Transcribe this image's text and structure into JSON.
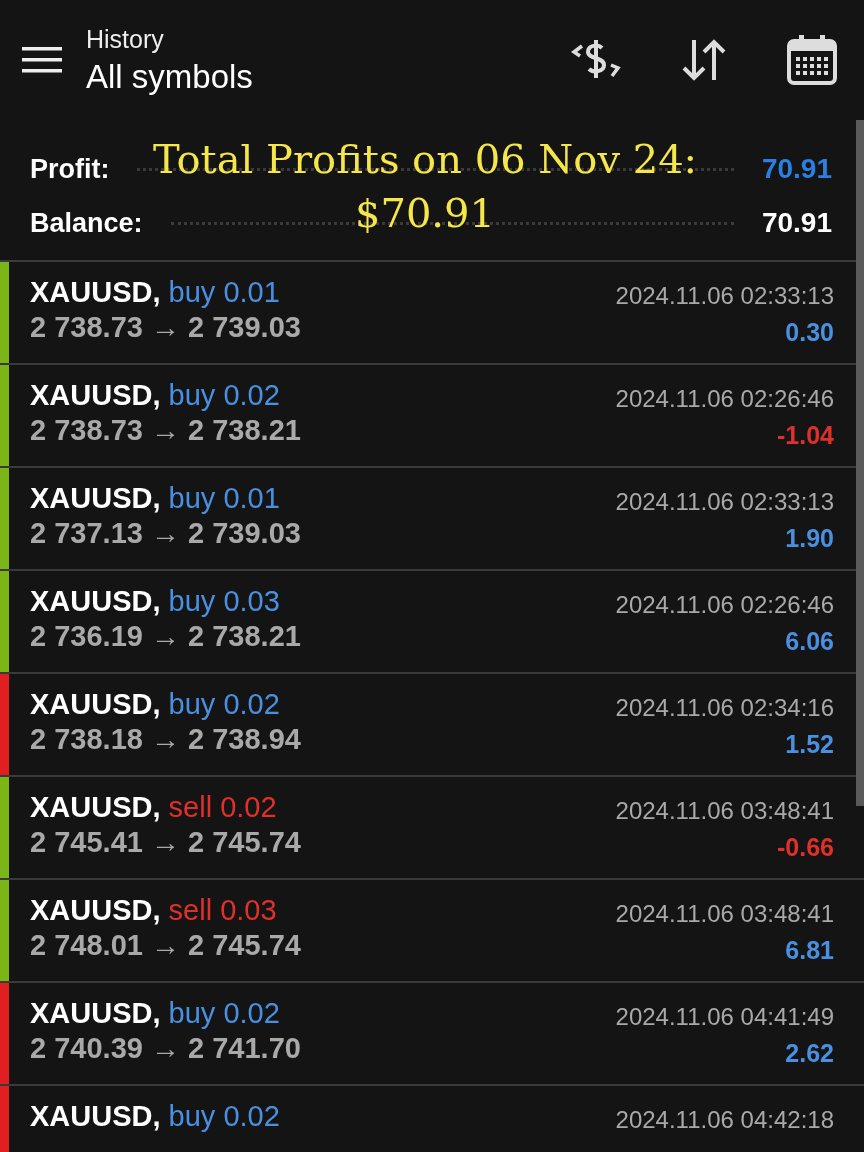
{
  "header": {
    "subtitle": "History",
    "title": "All symbols"
  },
  "summary": {
    "profit_label": "Profit:",
    "profit_value": "70.91",
    "balance_label": "Balance:",
    "balance_value": "70.91"
  },
  "caption": {
    "line_1": "Total Profits on 06 Nov 24:",
    "line_2": "$70.91"
  },
  "deals": [
    {
      "symbol": "XAUUSD,",
      "kind": "buy",
      "order": "buy 0.01",
      "prices": "2 738.73 → 2 739.03",
      "time": "2024.11.06 02:33:13",
      "profit": "0.30",
      "loss": false,
      "color": "#7cb518"
    },
    {
      "symbol": "XAUUSD,",
      "kind": "buy",
      "order": "buy 0.02",
      "prices": "2 738.73 → 2 738.21",
      "time": "2024.11.06 02:26:46",
      "profit": "-1.04",
      "loss": true,
      "color": "#7cb518"
    },
    {
      "symbol": "XAUUSD,",
      "kind": "buy",
      "order": "buy 0.01",
      "prices": "2 737.13 → 2 739.03",
      "time": "2024.11.06 02:33:13",
      "profit": "1.90",
      "loss": false,
      "color": "#7cb518"
    },
    {
      "symbol": "XAUUSD,",
      "kind": "buy",
      "order": "buy 0.03",
      "prices": "2 736.19 → 2 738.21",
      "time": "2024.11.06 02:26:46",
      "profit": "6.06",
      "loss": false,
      "color": "#7cb518"
    },
    {
      "symbol": "XAUUSD,",
      "kind": "buy",
      "order": "buy 0.02",
      "prices": "2 738.18 → 2 738.94",
      "time": "2024.11.06 02:34:16",
      "profit": "1.52",
      "loss": false,
      "color": "#e02020"
    },
    {
      "symbol": "XAUUSD,",
      "kind": "sell",
      "order": "sell 0.02",
      "prices": "2 745.41 → 2 745.74",
      "time": "2024.11.06 03:48:41",
      "profit": "-0.66",
      "loss": true,
      "color": "#7cb518"
    },
    {
      "symbol": "XAUUSD,",
      "kind": "sell",
      "order": "sell 0.03",
      "prices": "2 748.01 → 2 745.74",
      "time": "2024.11.06 03:48:41",
      "profit": "6.81",
      "loss": false,
      "color": "#7cb518"
    },
    {
      "symbol": "XAUUSD,",
      "kind": "buy",
      "order": "buy 0.02",
      "prices": "2 740.39 → 2 741.70",
      "time": "2024.11.06 04:41:49",
      "profit": "2.62",
      "loss": false,
      "color": "#e02020"
    },
    {
      "symbol": "XAUUSD,",
      "kind": "buy",
      "order": "buy 0.02",
      "time": "2024.11.06 04:42:18",
      "color": "#e02020"
    }
  ]
}
